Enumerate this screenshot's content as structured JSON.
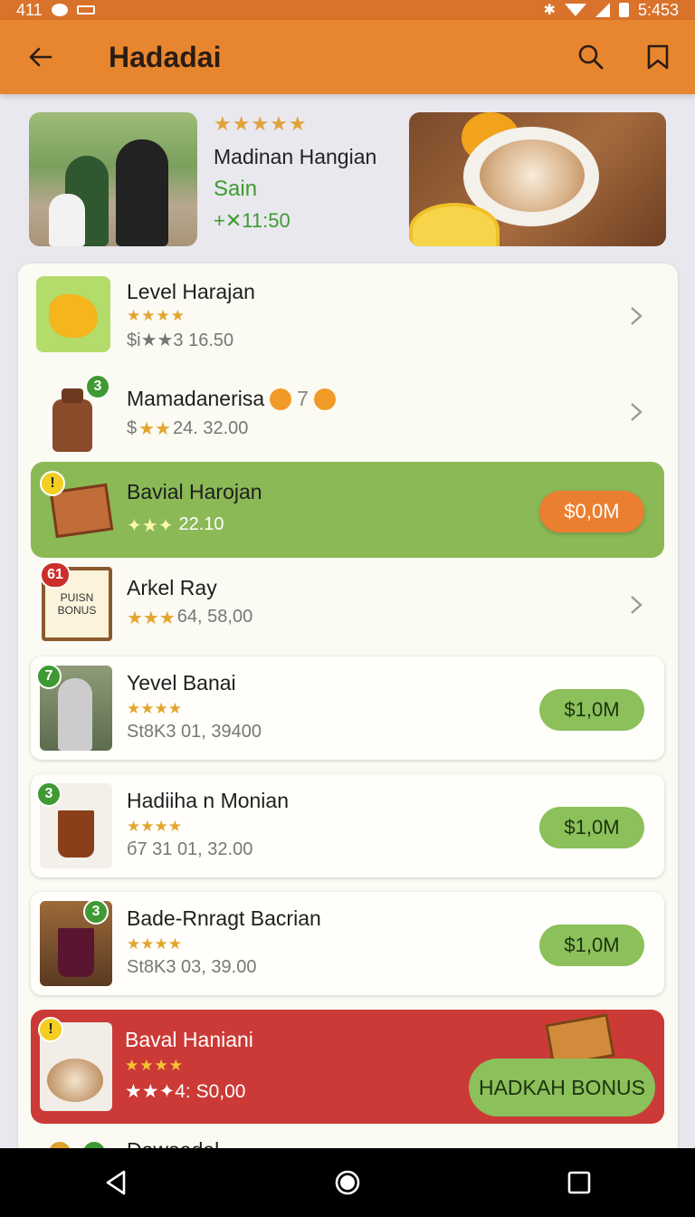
{
  "status_bar": {
    "time_left": "411",
    "time_right": "5:453"
  },
  "app_bar": {
    "title": "Hadadai",
    "back_icon": "arrow-left-icon",
    "search_icon": "search-icon",
    "bookmark_icon": "bookmark-icon"
  },
  "hero": {
    "stars": "★★★★★",
    "name": "Madinan Hangian",
    "subtitle": "Sain",
    "price": "+✕11:50"
  },
  "items": [
    {
      "name": "Level Harajan",
      "stars": "★★★★",
      "price": "$i★★3 16.50",
      "action": "chevron"
    },
    {
      "name": "Mamadanerisa",
      "extra": "7",
      "stars": "★★",
      "price_prefix": "$",
      "price": "24. 32.00",
      "badge": "3",
      "action": "chevron"
    },
    {
      "name": "Bavial Harojan",
      "stars": "✦★✦",
      "price": "22.10",
      "badge": "!",
      "button": "$0,0M"
    },
    {
      "name": "Arkel Ray",
      "stars": "★★★",
      "price": "64, 58,00",
      "badge": "61",
      "thumb_text_1": "PUISN",
      "thumb_text_2": "BONUS",
      "action": "chevron"
    },
    {
      "name": "Yevel Banai",
      "stars": "★★★★",
      "price": "St8K3 01, 39400",
      "badge": "7",
      "button": "$1,0M"
    },
    {
      "name": "Hadiiha n Monian",
      "stars": "★★★★",
      "price": "б7 31 01, 32.00",
      "badge": "3",
      "button": "$1,0M"
    },
    {
      "name": "Bade-Rnragt Bacrian",
      "stars": "★★★★",
      "price": "St8K3 03, 39.00",
      "badge": "3",
      "button": "$1,0M"
    },
    {
      "name": "Baval Haniani",
      "stars": "★★★★",
      "price": "★★✦4: S0,00",
      "badge": "!",
      "button": "HADKAH BONUS"
    },
    {
      "name": "Dawaadal"
    }
  ],
  "colors": {
    "accent": "#e8862f",
    "green": "#8cc05a",
    "red": "#cb3a36",
    "highlight_green": "#8ab956"
  }
}
